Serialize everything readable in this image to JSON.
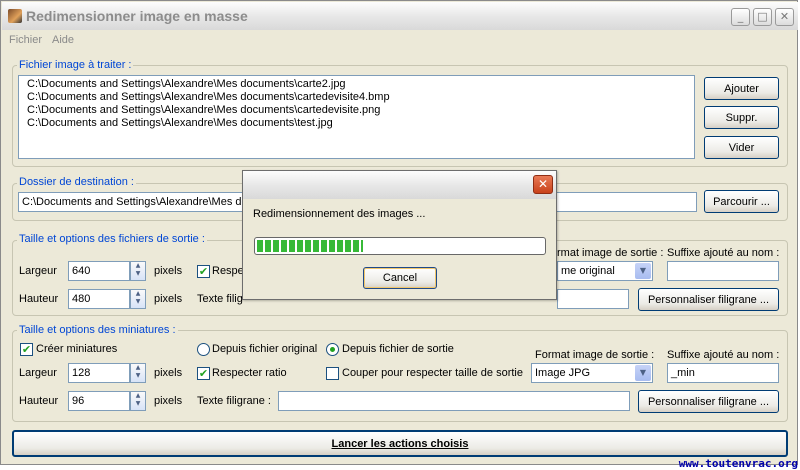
{
  "window": {
    "title": "Redimensionner image en masse",
    "controls": {
      "minimize": "_",
      "maximize": "□",
      "close": "✕"
    }
  },
  "menu": [
    "Fichier",
    "Aide"
  ],
  "source": {
    "legend": "Fichier image à traiter :",
    "files": [
      "C:\\Documents and Settings\\Alexandre\\Mes documents\\carte2.jpg",
      "C:\\Documents and Settings\\Alexandre\\Mes documents\\cartedevisite4.bmp",
      "C:\\Documents and Settings\\Alexandre\\Mes documents\\cartedevisite.png",
      "C:\\Documents and Settings\\Alexandre\\Mes documents\\test.jpg"
    ],
    "add_label": "Ajouter",
    "remove_label": "Suppr.",
    "clear_label": "Vider"
  },
  "destination": {
    "legend": "Dossier de destination :",
    "path": "C:\\Documents and Settings\\Alexandre\\Mes do",
    "browse_label": "Parcourir ..."
  },
  "output": {
    "legend": "Taille et options des fichiers de sortie :",
    "width_label": "Largeur",
    "width_value": "640",
    "height_label": "Hauteur",
    "height_value": "480",
    "unit": "pixels",
    "ratio_label": "Respec",
    "ratio_checked": true,
    "watermark_label": "Texte filig",
    "format_label": "rmat image de sortie :",
    "format_value": "me original",
    "suffix_label": "Suffixe ajouté au nom :",
    "suffix_value": "",
    "custom_watermark_label": "Personnaliser filigrane ..."
  },
  "thumbnails": {
    "legend": "Taille et options des miniatures :",
    "create_label": "Créer miniatures",
    "create_checked": true,
    "from_original_label": "Depuis fichier original",
    "from_output_label": "Depuis fichier de sortie",
    "source_selected": "output",
    "width_label": "Largeur",
    "width_value": "128",
    "height_label": "Hauteur",
    "height_value": "96",
    "unit": "pixels",
    "ratio_label": "Respecter ratio",
    "ratio_checked": true,
    "crop_label": "Couper pour respecter taille de sortie",
    "crop_checked": false,
    "watermark_label": "Texte filigrane :",
    "watermark_value": "",
    "format_label": "Format image de sortie :",
    "format_value": "Image JPG",
    "suffix_label": "Suffixe ajouté au nom :",
    "suffix_value": "_min",
    "custom_watermark_label": "Personnaliser filigrane ..."
  },
  "run_label": "Lancer les actions choisis",
  "dialog": {
    "message": "Redimensionnement des images ...",
    "progress_fraction": 0.37,
    "cancel_label": "Cancel",
    "close": "✕"
  },
  "watermark": "www.toutenvrac.org",
  "colors": {
    "legend": "#0046d5",
    "check": "#21a121",
    "progress": "#37b937",
    "face": "#ece9d8"
  }
}
